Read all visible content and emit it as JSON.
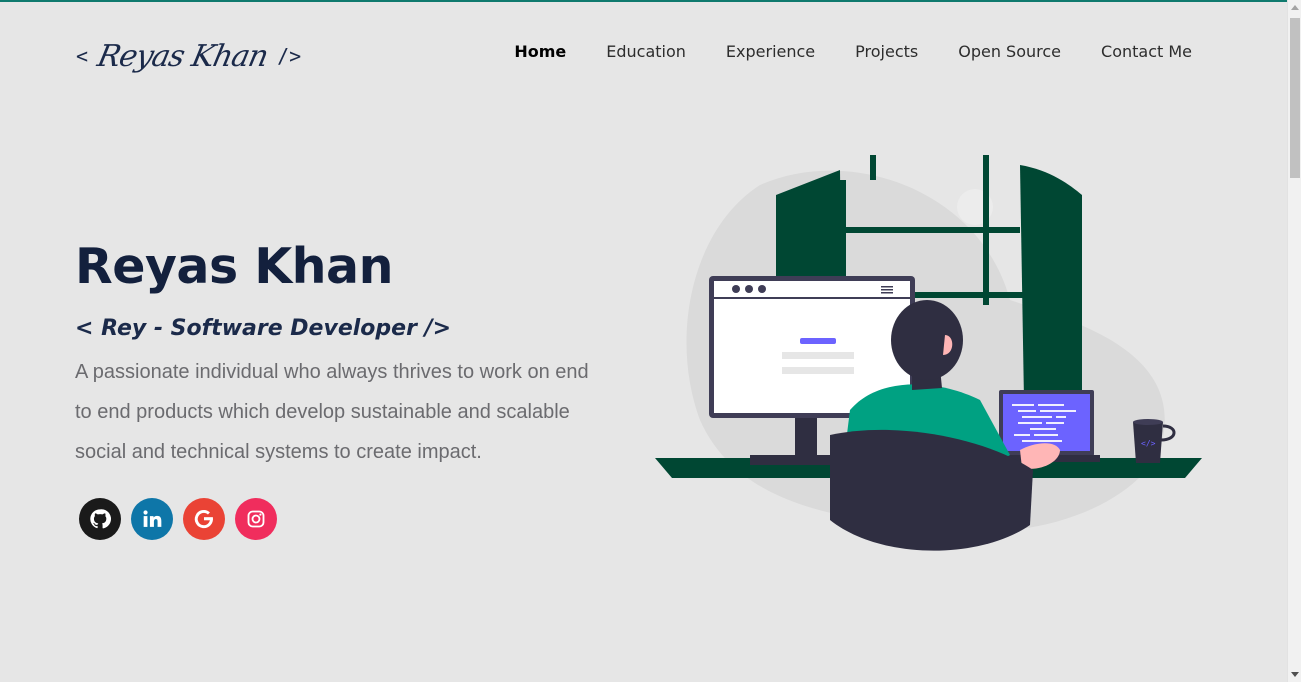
{
  "logo": {
    "open": "<",
    "name": "Reyas Khan",
    "close": "/>"
  },
  "nav": {
    "items": [
      "Home",
      "Education",
      "Experience",
      "Projects",
      "Open Source",
      "Contact Me"
    ],
    "active": "Home"
  },
  "hero": {
    "name": "Reyas Khan",
    "subtitle": "< Rey - Software Developer />",
    "description": "A passionate individual who always thrives to work on end to end products which develop sustainable and scalable social and technical systems to create impact."
  },
  "socials": [
    {
      "icon": "github-icon",
      "color": "#1a1a1a"
    },
    {
      "icon": "linkedin-icon",
      "color": "#0e76a8"
    },
    {
      "icon": "google-icon",
      "color": "#ea4335"
    },
    {
      "icon": "instagram-icon",
      "color": "#f02d5d"
    }
  ],
  "colors": {
    "background": "#e6e6e6",
    "accent_top": "#0f7a6e",
    "heading": "#13203d",
    "body_text": "#6b6b6f",
    "illustration_dark_green": "#004733",
    "illustration_teal": "#00a182",
    "illustration_purple": "#6c63ff"
  }
}
